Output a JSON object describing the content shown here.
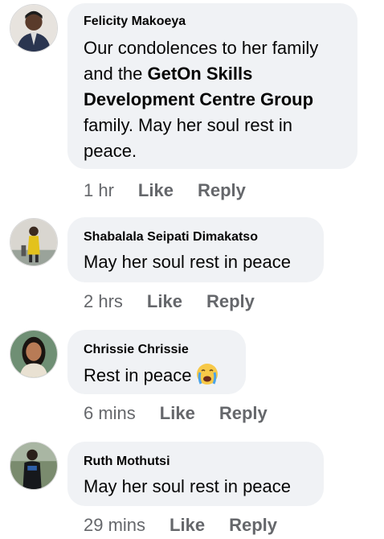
{
  "comments": [
    {
      "author": "Felicity Makoeya",
      "text_parts": [
        {
          "t": "Our condolences to her family and the ",
          "bold": false
        },
        {
          "t": "GetOn Skills Development Centre Group",
          "bold": true
        },
        {
          "t": " family. May her soul rest in peace.",
          "bold": false
        }
      ],
      "time": "1 hr",
      "like": "Like",
      "reply": "Reply"
    },
    {
      "author": "Shabalala Seipati Dimakatso",
      "text": "May her soul rest in peace",
      "time": "2 hrs",
      "like": "Like",
      "reply": "Reply"
    },
    {
      "author": "Chrissie Chrissie",
      "text": "Rest in peace",
      "emoji": "crying-face-emoji",
      "time": "6 mins",
      "like": "Like",
      "reply": "Reply"
    },
    {
      "author": "Ruth Mothutsi",
      "text": "May her soul rest in peace",
      "time": "29 mins",
      "like": "Like",
      "reply": "Reply"
    }
  ],
  "colors": {
    "bubble": "#f0f2f5",
    "secondary_text": "#65676b",
    "primary_text": "#050505"
  }
}
